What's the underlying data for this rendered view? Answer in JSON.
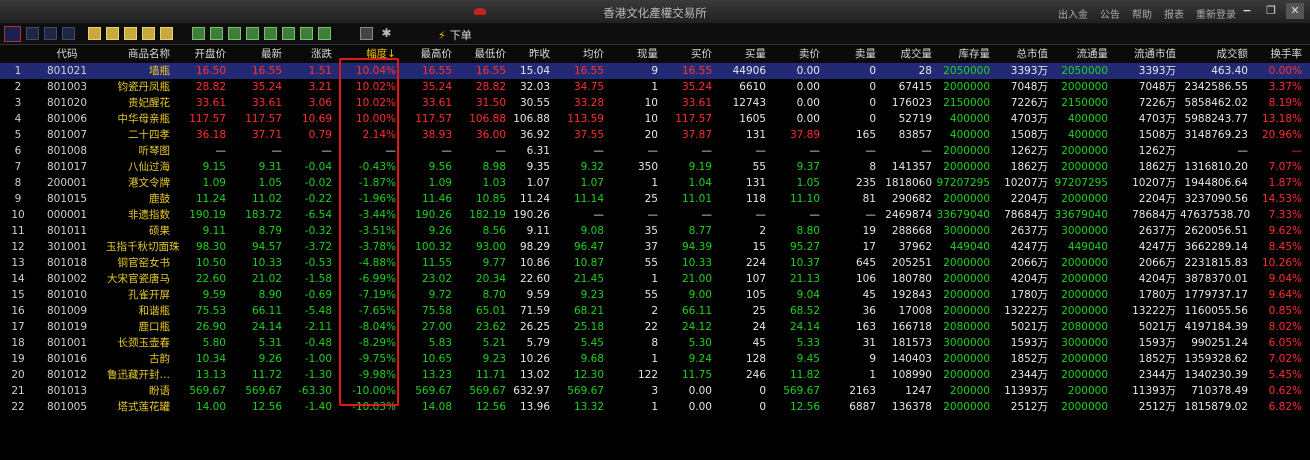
{
  "titlebar": {
    "title": "香港文化產權交易所",
    "links": [
      "出入金",
      "公告",
      "帮助",
      "报表",
      "重新登录"
    ]
  },
  "toolbar": {
    "order_label": "下单",
    "icons": [
      "chart-icon",
      "kline-icon",
      "volume-icon",
      "list-icon",
      "y1-icon",
      "y2-icon",
      "y3-icon",
      "y4-icon",
      "y5-icon",
      "g1-icon",
      "g2-icon",
      "g3-icon",
      "g4-icon",
      "g5-icon",
      "g6-icon",
      "g7-icon",
      "g8-icon",
      "settings-doc-icon",
      "gear-icon"
    ]
  },
  "colors": {
    "up": "#ff3030",
    "down": "#20d020",
    "flat": "#e6e6e6",
    "code": "#d0d0d0",
    "name": "#e8c92c",
    "volume": "#e6e6e6",
    "stock": "#20d020",
    "highlight": "#e01818",
    "selected_row": "#232a75"
  },
  "table": {
    "headers": [
      "",
      "代码",
      "商品名称",
      "开盘价",
      "最新",
      "涨跌",
      "幅度↓",
      "最高价",
      "最低价",
      "昨收",
      "均价",
      "现量",
      "买价",
      "买量",
      "卖价",
      "卖量",
      "成交量",
      "库存量",
      "总市值",
      "流通量",
      "流通市值",
      "成交额",
      "换手率"
    ],
    "sort_column": "幅度",
    "rows": [
      {
        "n": "1",
        "code": "801021",
        "name": "墙瓶",
        "open": "16.50",
        "last": "16.55",
        "chg": "1.51",
        "pct": "10.04%",
        "high": "16.55",
        "low": "16.55",
        "prev": "15.04",
        "avg": "16.55",
        "cur": "9",
        "bid": "16.55",
        "bidv": "44906",
        "ask": "0.00",
        "askv": "0",
        "vol": "28",
        "stock": "2050000",
        "mcap": "3393万",
        "float": "2050000",
        "fmcap": "3393万",
        "amt": "463.40",
        "turn": "0.00%",
        "dir": "up"
      },
      {
        "n": "2",
        "code": "801003",
        "name": "钧瓷丹凤瓶",
        "open": "28.82",
        "last": "35.24",
        "chg": "3.21",
        "pct": "10.02%",
        "high": "35.24",
        "low": "28.82",
        "prev": "32.03",
        "avg": "34.75",
        "cur": "1",
        "bid": "35.24",
        "bidv": "6610",
        "ask": "0.00",
        "askv": "0",
        "vol": "67415",
        "stock": "2000000",
        "mcap": "7048万",
        "float": "2000000",
        "fmcap": "7048万",
        "amt": "2342586.55",
        "turn": "3.37%",
        "dir": "up"
      },
      {
        "n": "3",
        "code": "801020",
        "name": "贵妃醒花",
        "open": "33.61",
        "last": "33.61",
        "chg": "3.06",
        "pct": "10.02%",
        "high": "33.61",
        "low": "31.50",
        "prev": "30.55",
        "avg": "33.28",
        "cur": "10",
        "bid": "33.61",
        "bidv": "12743",
        "ask": "0.00",
        "askv": "0",
        "vol": "176023",
        "stock": "2150000",
        "mcap": "7226万",
        "float": "2150000",
        "fmcap": "7226万",
        "amt": "5858462.02",
        "turn": "8.19%",
        "dir": "up"
      },
      {
        "n": "4",
        "code": "801006",
        "name": "中华母亲瓶",
        "open": "117.57",
        "last": "117.57",
        "chg": "10.69",
        "pct": "10.00%",
        "high": "117.57",
        "low": "106.88",
        "prev": "106.88",
        "avg": "113.59",
        "cur": "10",
        "bid": "117.57",
        "bidv": "1605",
        "ask": "0.00",
        "askv": "0",
        "vol": "52719",
        "stock": "400000",
        "mcap": "4703万",
        "float": "400000",
        "fmcap": "4703万",
        "amt": "5988243.77",
        "turn": "13.18%",
        "dir": "up"
      },
      {
        "n": "5",
        "code": "801007",
        "name": "二十四孝",
        "open": "36.18",
        "last": "37.71",
        "chg": "0.79",
        "pct": "2.14%",
        "high": "38.93",
        "low": "36.00",
        "prev": "36.92",
        "avg": "37.55",
        "cur": "20",
        "bid": "37.87",
        "bidv": "131",
        "ask": "37.89",
        "askv": "165",
        "vol": "83857",
        "stock": "400000",
        "mcap": "1508万",
        "float": "400000",
        "fmcap": "1508万",
        "amt": "3148769.23",
        "turn": "20.96%",
        "dir": "up"
      },
      {
        "n": "6",
        "code": "801008",
        "name": "听琴图",
        "open": "—",
        "last": "—",
        "chg": "—",
        "pct": "—",
        "high": "—",
        "low": "—",
        "prev": "6.31",
        "avg": "—",
        "cur": "—",
        "bid": "—",
        "bidv": "—",
        "ask": "—",
        "askv": "—",
        "vol": "—",
        "stock": "2000000",
        "mcap": "1262万",
        "float": "2000000",
        "fmcap": "1262万",
        "amt": "—",
        "turn": "—",
        "dir": "flat"
      },
      {
        "n": "7",
        "code": "801017",
        "name": "八仙过海",
        "open": "9.15",
        "last": "9.31",
        "chg": "-0.04",
        "pct": "-0.43%",
        "high": "9.56",
        "low": "8.98",
        "prev": "9.35",
        "avg": "9.32",
        "cur": "350",
        "bid": "9.19",
        "bidv": "55",
        "ask": "9.37",
        "askv": "8",
        "vol": "141357",
        "stock": "2000000",
        "mcap": "1862万",
        "float": "2000000",
        "fmcap": "1862万",
        "amt": "1316810.20",
        "turn": "7.07%",
        "dir": "down"
      },
      {
        "n": "8",
        "code": "200001",
        "name": "港文令牌",
        "open": "1.09",
        "last": "1.05",
        "chg": "-0.02",
        "pct": "-1.87%",
        "high": "1.09",
        "low": "1.03",
        "prev": "1.07",
        "avg": "1.07",
        "cur": "1",
        "bid": "1.04",
        "bidv": "131",
        "ask": "1.05",
        "askv": "235",
        "vol": "1818060",
        "stock": "97207295",
        "mcap": "10207万",
        "float": "97207295",
        "fmcap": "10207万",
        "amt": "1944806.64",
        "turn": "1.87%",
        "dir": "down"
      },
      {
        "n": "9",
        "code": "801015",
        "name": "鹿鼓",
        "open": "11.24",
        "last": "11.02",
        "chg": "-0.22",
        "pct": "-1.96%",
        "high": "11.46",
        "low": "10.85",
        "prev": "11.24",
        "avg": "11.14",
        "cur": "25",
        "bid": "11.01",
        "bidv": "118",
        "ask": "11.10",
        "askv": "81",
        "vol": "290682",
        "stock": "2000000",
        "mcap": "2204万",
        "float": "2000000",
        "fmcap": "2204万",
        "amt": "3237090.56",
        "turn": "14.53%",
        "dir": "down"
      },
      {
        "n": "10",
        "code": "000001",
        "name": "非遗指数",
        "open": "190.19",
        "last": "183.72",
        "chg": "-6.54",
        "pct": "-3.44%",
        "high": "190.26",
        "low": "182.19",
        "prev": "190.26",
        "avg": "—",
        "cur": "—",
        "bid": "—",
        "bidv": "—",
        "ask": "—",
        "askv": "—",
        "vol": "2469874",
        "stock": "33679040",
        "mcap": "78684万",
        "float": "33679040",
        "fmcap": "78684万",
        "amt": "47637538.70",
        "turn": "7.33%",
        "dir": "down"
      },
      {
        "n": "11",
        "code": "801011",
        "name": "硕果",
        "open": "9.11",
        "last": "8.79",
        "chg": "-0.32",
        "pct": "-3.51%",
        "high": "9.26",
        "low": "8.56",
        "prev": "9.11",
        "avg": "9.08",
        "cur": "35",
        "bid": "8.77",
        "bidv": "2",
        "ask": "8.80",
        "askv": "19",
        "vol": "288668",
        "stock": "3000000",
        "mcap": "2637万",
        "float": "3000000",
        "fmcap": "2637万",
        "amt": "2620056.51",
        "turn": "9.62%",
        "dir": "down"
      },
      {
        "n": "12",
        "code": "301001",
        "name": "玉指千秋切面珠",
        "open": "98.30",
        "last": "94.57",
        "chg": "-3.72",
        "pct": "-3.78%",
        "high": "100.32",
        "low": "93.00",
        "prev": "98.29",
        "avg": "96.47",
        "cur": "37",
        "bid": "94.39",
        "bidv": "15",
        "ask": "95.27",
        "askv": "17",
        "vol": "37962",
        "stock": "449040",
        "mcap": "4247万",
        "float": "449040",
        "fmcap": "4247万",
        "amt": "3662289.14",
        "turn": "8.45%",
        "dir": "down"
      },
      {
        "n": "13",
        "code": "801018",
        "name": "铜官窑女书",
        "open": "10.50",
        "last": "10.33",
        "chg": "-0.53",
        "pct": "-4.88%",
        "high": "11.55",
        "low": "9.77",
        "prev": "10.86",
        "avg": "10.87",
        "cur": "55",
        "bid": "10.33",
        "bidv": "224",
        "ask": "10.37",
        "askv": "645",
        "vol": "205251",
        "stock": "2000000",
        "mcap": "2066万",
        "float": "2000000",
        "fmcap": "2066万",
        "amt": "2231815.83",
        "turn": "10.26%",
        "dir": "down"
      },
      {
        "n": "14",
        "code": "801002",
        "name": "大宋官瓷唐马",
        "open": "22.60",
        "last": "21.02",
        "chg": "-1.58",
        "pct": "-6.99%",
        "high": "23.02",
        "low": "20.34",
        "prev": "22.60",
        "avg": "21.45",
        "cur": "1",
        "bid": "21.00",
        "bidv": "107",
        "ask": "21.13",
        "askv": "106",
        "vol": "180780",
        "stock": "2000000",
        "mcap": "4204万",
        "float": "2000000",
        "fmcap": "4204万",
        "amt": "3878370.01",
        "turn": "9.04%",
        "dir": "down"
      },
      {
        "n": "15",
        "code": "801010",
        "name": "孔雀开屏",
        "open": "9.59",
        "last": "8.90",
        "chg": "-0.69",
        "pct": "-7.19%",
        "high": "9.72",
        "low": "8.70",
        "prev": "9.59",
        "avg": "9.23",
        "cur": "55",
        "bid": "9.00",
        "bidv": "105",
        "ask": "9.04",
        "askv": "45",
        "vol": "192843",
        "stock": "2000000",
        "mcap": "1780万",
        "float": "2000000",
        "fmcap": "1780万",
        "amt": "1779737.17",
        "turn": "9.64%",
        "dir": "down"
      },
      {
        "n": "16",
        "code": "801009",
        "name": "和谐瓶",
        "open": "75.53",
        "last": "66.11",
        "chg": "-5.48",
        "pct": "-7.65%",
        "high": "75.58",
        "low": "65.01",
        "prev": "71.59",
        "avg": "68.21",
        "cur": "2",
        "bid": "66.11",
        "bidv": "25",
        "ask": "68.52",
        "askv": "36",
        "vol": "17008",
        "stock": "2000000",
        "mcap": "13222万",
        "float": "2000000",
        "fmcap": "13222万",
        "amt": "1160055.56",
        "turn": "0.85%",
        "dir": "down"
      },
      {
        "n": "17",
        "code": "801019",
        "name": "鹿口瓶",
        "open": "26.90",
        "last": "24.14",
        "chg": "-2.11",
        "pct": "-8.04%",
        "high": "27.00",
        "low": "23.62",
        "prev": "26.25",
        "avg": "25.18",
        "cur": "22",
        "bid": "24.12",
        "bidv": "24",
        "ask": "24.14",
        "askv": "163",
        "vol": "166718",
        "stock": "2080000",
        "mcap": "5021万",
        "float": "2080000",
        "fmcap": "5021万",
        "amt": "4197184.39",
        "turn": "8.02%",
        "dir": "down"
      },
      {
        "n": "18",
        "code": "801001",
        "name": "长颈玉壶春",
        "open": "5.80",
        "last": "5.31",
        "chg": "-0.48",
        "pct": "-8.29%",
        "high": "5.83",
        "low": "5.21",
        "prev": "5.79",
        "avg": "5.45",
        "cur": "8",
        "bid": "5.30",
        "bidv": "45",
        "ask": "5.33",
        "askv": "31",
        "vol": "181573",
        "stock": "3000000",
        "mcap": "1593万",
        "float": "3000000",
        "fmcap": "1593万",
        "amt": "990251.24",
        "turn": "6.05%",
        "dir": "down"
      },
      {
        "n": "19",
        "code": "801016",
        "name": "古韵",
        "open": "10.34",
        "last": "9.26",
        "chg": "-1.00",
        "pct": "-9.75%",
        "high": "10.65",
        "low": "9.23",
        "prev": "10.26",
        "avg": "9.68",
        "cur": "1",
        "bid": "9.24",
        "bidv": "128",
        "ask": "9.45",
        "askv": "9",
        "vol": "140403",
        "stock": "2000000",
        "mcap": "1852万",
        "float": "2000000",
        "fmcap": "1852万",
        "amt": "1359328.62",
        "turn": "7.02%",
        "dir": "down"
      },
      {
        "n": "20",
        "code": "801012",
        "name": "鲁迅藏开封…",
        "open": "13.13",
        "last": "11.72",
        "chg": "-1.30",
        "pct": "-9.98%",
        "high": "13.23",
        "low": "11.71",
        "prev": "13.02",
        "avg": "12.30",
        "cur": "122",
        "bid": "11.75",
        "bidv": "246",
        "ask": "11.82",
        "askv": "1",
        "vol": "108990",
        "stock": "2000000",
        "mcap": "2344万",
        "float": "2000000",
        "fmcap": "2344万",
        "amt": "1340230.39",
        "turn": "5.45%",
        "dir": "down"
      },
      {
        "n": "21",
        "code": "801013",
        "name": "盼语",
        "open": "569.67",
        "last": "569.67",
        "chg": "-63.30",
        "pct": "-10.00%",
        "high": "569.67",
        "low": "569.67",
        "prev": "632.97",
        "avg": "569.67",
        "cur": "3",
        "bid": "0.00",
        "bidv": "0",
        "ask": "569.67",
        "askv": "2163",
        "vol": "1247",
        "stock": "200000",
        "mcap": "11393万",
        "float": "200000",
        "fmcap": "11393万",
        "amt": "710378.49",
        "turn": "0.62%",
        "dir": "down"
      },
      {
        "n": "22",
        "code": "801005",
        "name": "塔式莲花罐",
        "open": "14.00",
        "last": "12.56",
        "chg": "-1.40",
        "pct": "-10.03%",
        "high": "14.08",
        "low": "12.56",
        "prev": "13.96",
        "avg": "13.32",
        "cur": "1",
        "bid": "0.00",
        "bidv": "0",
        "ask": "12.56",
        "askv": "6887",
        "vol": "136378",
        "stock": "2000000",
        "mcap": "2512万",
        "float": "2000000",
        "fmcap": "2512万",
        "amt": "1815879.02",
        "turn": "6.82%",
        "dir": "down"
      }
    ]
  }
}
